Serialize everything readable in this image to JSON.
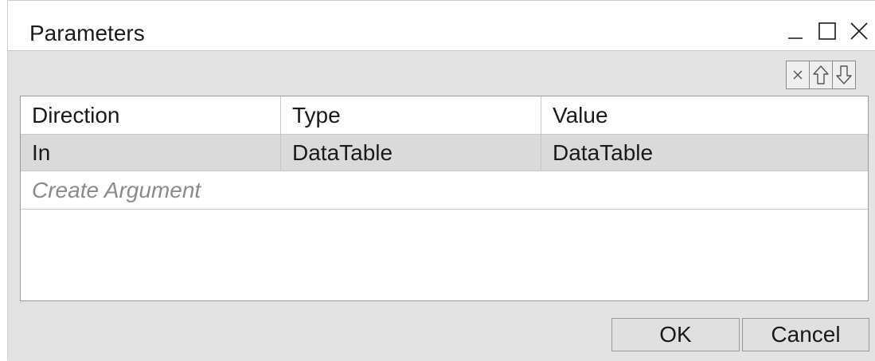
{
  "window": {
    "title": "Parameters",
    "controls": {
      "minimize_icon": "minimize-icon",
      "maximize_icon": "maximize-icon",
      "close_icon": "close-icon"
    }
  },
  "toolbar": {
    "icons": [
      "delete-icon",
      "move-up-icon",
      "move-down-icon"
    ]
  },
  "grid": {
    "columns": [
      "Direction",
      "Type",
      "Value"
    ],
    "rows": [
      [
        "In",
        "DataTable",
        "DataTable"
      ]
    ],
    "create_placeholder": "Create Argument"
  },
  "buttons": {
    "ok": "OK",
    "cancel": "Cancel"
  },
  "colors": {
    "panel_background": "#e3e3e3",
    "selected_row": "#dadada",
    "placeholder_text": "#8a8a8a"
  }
}
